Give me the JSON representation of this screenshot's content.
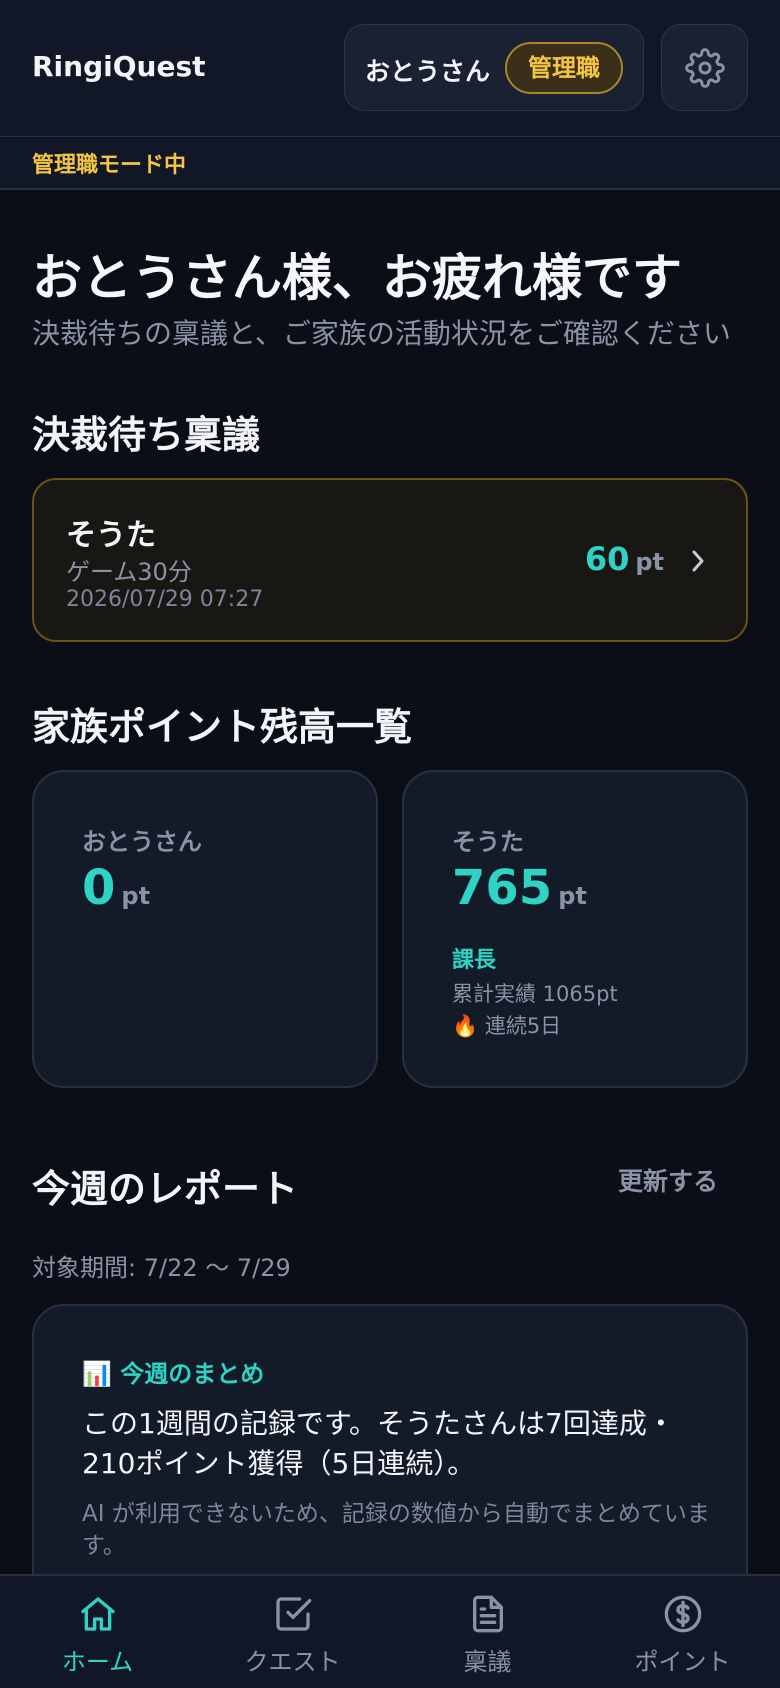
{
  "header": {
    "brand": "RingiQuest",
    "user_name": "おとうさん",
    "role_badge": "管理職",
    "mode_text": "管理職モード中"
  },
  "greeting": {
    "title": "おとうさん様、お疲れ様です",
    "subtitle": "決裁待ちの稟議と、ご家族の活動状況をご確認ください"
  },
  "pending": {
    "section_title": "決裁待ち稟議",
    "items": [
      {
        "name": "そうた",
        "item": "ゲーム30分",
        "date": "2026/07/29 07:27",
        "points": "60",
        "unit": "pt"
      }
    ]
  },
  "balances": {
    "section_title": "家族ポイント残高一覧",
    "members": [
      {
        "name": "おとうさん",
        "points": "0",
        "unit": "pt"
      },
      {
        "name": "そうた",
        "points": "765",
        "unit": "pt",
        "rank": "課長",
        "total": "累計実績 1065pt",
        "streak": "🔥 連続5日"
      }
    ]
  },
  "report": {
    "section_title": "今週のレポート",
    "refresh_label": "更新する",
    "period": "対象期間: 7/22 〜 7/29",
    "summary_title": "📊 今週のまとめ",
    "summary_body": "この1週間の記録です。そうたさんは7回達成・210ポイント獲得（5日連続）。",
    "summary_note": "AI が利用できないため、記録の数値から自動でまとめています。"
  },
  "nav": {
    "items": [
      {
        "label": "ホーム",
        "icon": "home-icon",
        "active": true
      },
      {
        "label": "クエスト",
        "icon": "checkbox-icon",
        "active": false
      },
      {
        "label": "稟議",
        "icon": "document-icon",
        "active": false
      },
      {
        "label": "ポイント",
        "icon": "coin-icon",
        "active": false
      }
    ]
  },
  "colors": {
    "accent": "#2ed3c6",
    "manager_gold": "#f5c542",
    "background": "#0b0e16",
    "card": "#131a28"
  }
}
